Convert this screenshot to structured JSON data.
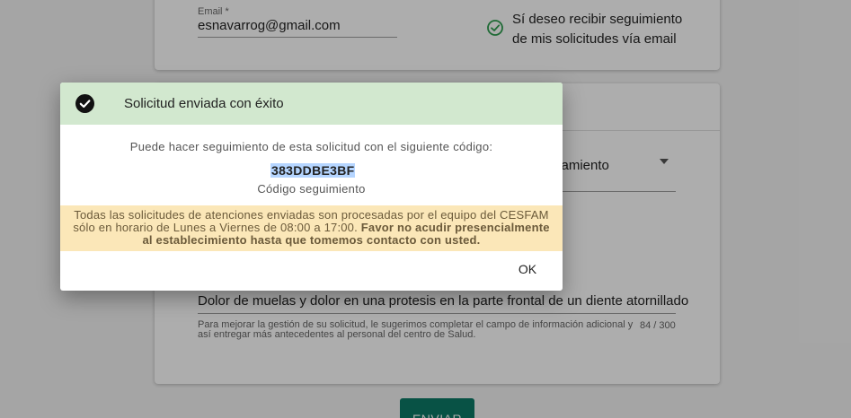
{
  "contact": {
    "email_label": "Email *",
    "email_value": "esnavarrog@gmail.com",
    "consent_text": "Sí deseo recibir seguimiento de mis solicitudes vía email"
  },
  "request": {
    "select_value_partial": "atamiento",
    "description_value": "Dolor de muelas y dolor en una protesis en la parte frontal de un diente atornillado",
    "helper_text": "Para mejorar la gestión de su solicitud, le sugerimos completar el campo de información adicional y así entregar más antecedentes al personal del centro de Salud.",
    "counter": "84 / 300",
    "submit_label": "ENVIAR"
  },
  "dialog": {
    "title": "Solicitud enviada con éxito",
    "message": "Puede hacer seguimiento de esta solicitud con el siguiente código:",
    "code": "383DDBE3BF",
    "code_label": "Código seguimiento",
    "warning_normal": "Todas las solicitudes de atenciones enviadas son procesadas por el equipo del CESFAM sólo en horario de Lunes a Viernes de 08:00 a 17:00. ",
    "warning_bold": "Favor no acudir presencialmente al establecimiento hasta que tomemos contacto con usted.",
    "ok_label": "OK"
  },
  "colors": {
    "success_header": "#d2e8cf",
    "warning_background": "#fbe7b8",
    "primary_button": "#0d7a66",
    "check_green": "#2e9d4f",
    "code_highlight": "#b5d5ff"
  },
  "icons": {
    "consent": "check-circle-outline-icon",
    "success": "check-circle-filled-icon",
    "select": "dropdown-arrow-icon"
  }
}
